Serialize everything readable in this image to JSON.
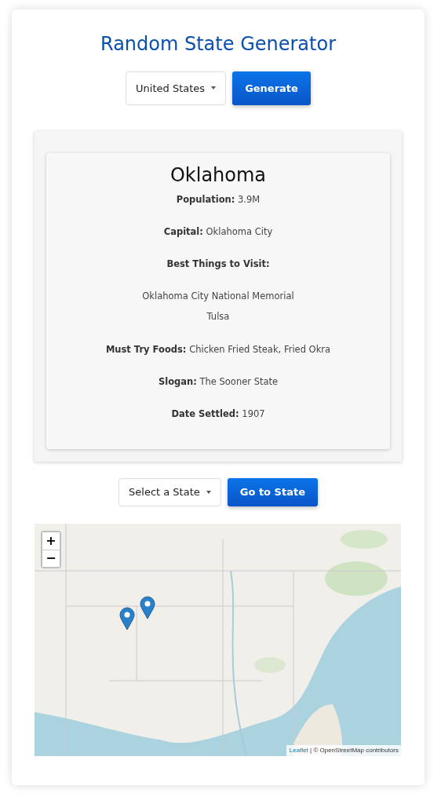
{
  "title": "Random State Generator",
  "country_select": {
    "value": "United States"
  },
  "generate_button": "Generate",
  "state": {
    "name": "Oklahoma",
    "fields": [
      {
        "kind": "text",
        "label": "Population:",
        "value": "3.9M"
      },
      {
        "kind": "text",
        "label": "Capital:",
        "value": "Oklahoma City"
      },
      {
        "kind": "list",
        "label": "Best Things to Visit:",
        "items": [
          "Oklahoma City National Memorial",
          "Tulsa"
        ]
      },
      {
        "kind": "text",
        "label": "Must Try Foods:",
        "value": "Chicken Fried Steak, Fried Okra"
      },
      {
        "kind": "text",
        "label": "Slogan:",
        "value": "The Sooner State"
      },
      {
        "kind": "text",
        "label": "Date Settled:",
        "value": "1907"
      }
    ]
  },
  "state_select": {
    "value": "Select a State"
  },
  "go_button": "Go to State",
  "map": {
    "zoom_in": "+",
    "zoom_out": "−",
    "attribution_link": "Leaflet",
    "attribution_text": "| © OpenStreetMap contributors"
  }
}
